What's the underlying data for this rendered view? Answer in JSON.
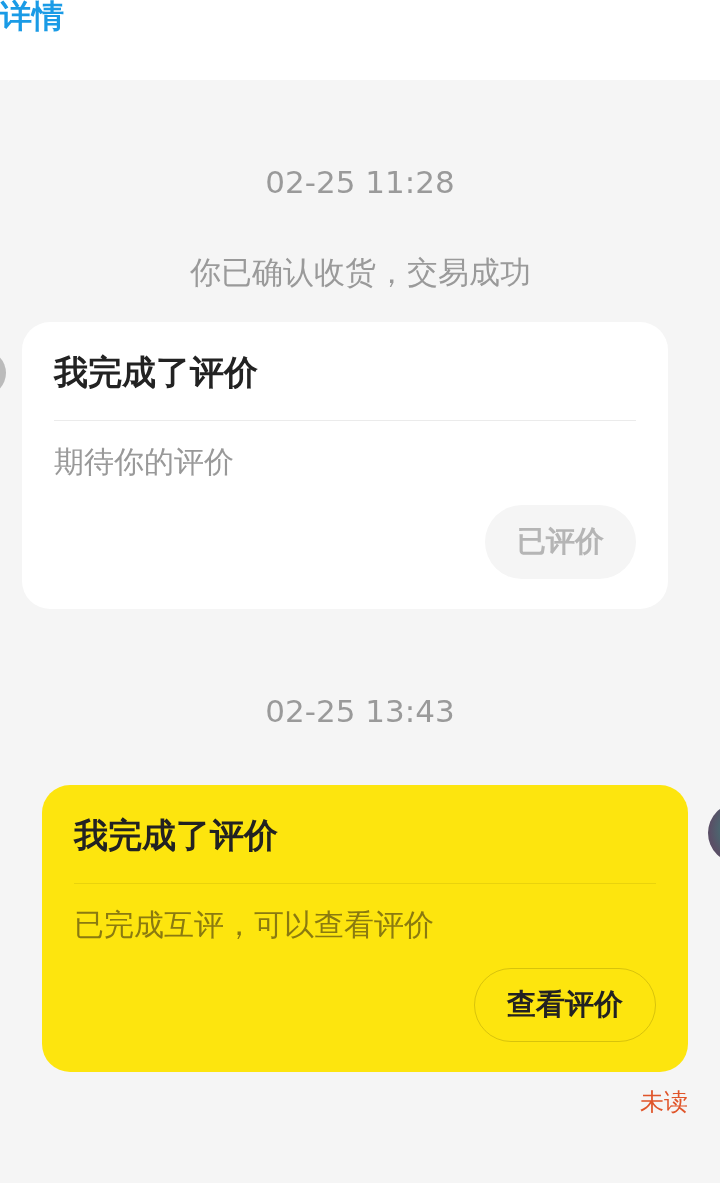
{
  "header": {
    "title": "详情"
  },
  "messages": [
    {
      "kind": "system",
      "time": "02-25 11:28",
      "note": "你已确认收货，交易成功"
    },
    {
      "kind": "received",
      "title": "我完成了评价",
      "body": "期待你的评价",
      "button": {
        "label": "已评价",
        "disabled": true
      }
    },
    {
      "kind": "time",
      "time": "02-25 13:43"
    },
    {
      "kind": "sent",
      "title": "我完成了评价",
      "body": "已完成互评，可以查看评价",
      "button": {
        "label": "查看评价",
        "disabled": false
      },
      "status": "未读"
    }
  ]
}
